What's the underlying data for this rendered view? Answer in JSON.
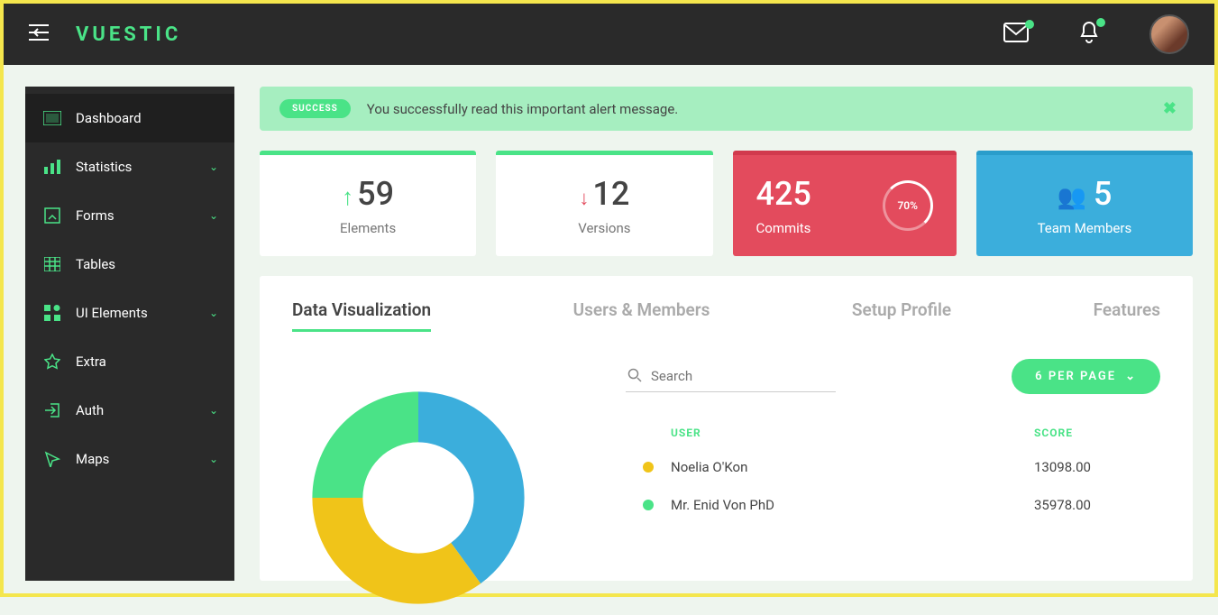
{
  "brand": "VUESTIC",
  "sidebar": {
    "items": [
      {
        "label": "Dashboard",
        "icon": "dashboard",
        "expandable": false,
        "active": true
      },
      {
        "label": "Statistics",
        "icon": "stats",
        "expandable": true
      },
      {
        "label": "Forms",
        "icon": "forms",
        "expandable": true
      },
      {
        "label": "Tables",
        "icon": "tables",
        "expandable": false
      },
      {
        "label": "UI Elements",
        "icon": "ui",
        "expandable": true
      },
      {
        "label": "Extra",
        "icon": "star",
        "expandable": false
      },
      {
        "label": "Auth",
        "icon": "auth",
        "expandable": true
      },
      {
        "label": "Maps",
        "icon": "maps",
        "expandable": true
      }
    ]
  },
  "alert": {
    "badge": "SUCCESS",
    "text": "You successfully read this important alert message."
  },
  "stats": [
    {
      "value": "59",
      "label": "Elements",
      "trend": "up"
    },
    {
      "value": "12",
      "label": "Versions",
      "trend": "down"
    },
    {
      "value": "425",
      "label": "Commits",
      "variant": "red",
      "ring": "70%"
    },
    {
      "value": "5",
      "label": "Team Members",
      "variant": "blue",
      "icon": "people"
    }
  ],
  "tabs": [
    "Data Visualization",
    "Users & Members",
    "Setup Profile",
    "Features"
  ],
  "activeTab": 0,
  "search": {
    "placeholder": "Search"
  },
  "perpage": "6 PER PAGE",
  "table": {
    "headers": {
      "user": "USER",
      "score": "SCORE"
    },
    "rows": [
      {
        "color": "#f0c419",
        "user": "Noelia O'Kon",
        "score": "13098.00"
      },
      {
        "color": "#4ae387",
        "user": "Mr. Enid Von PhD",
        "score": "35978.00"
      }
    ]
  },
  "chart_data": {
    "type": "pie",
    "series": [
      {
        "name": "Blue",
        "value": 40,
        "color": "#3baedc"
      },
      {
        "name": "Yellow",
        "value": 35,
        "color": "#f0c419"
      },
      {
        "name": "Green",
        "value": 25,
        "color": "#4ae387"
      }
    ]
  }
}
